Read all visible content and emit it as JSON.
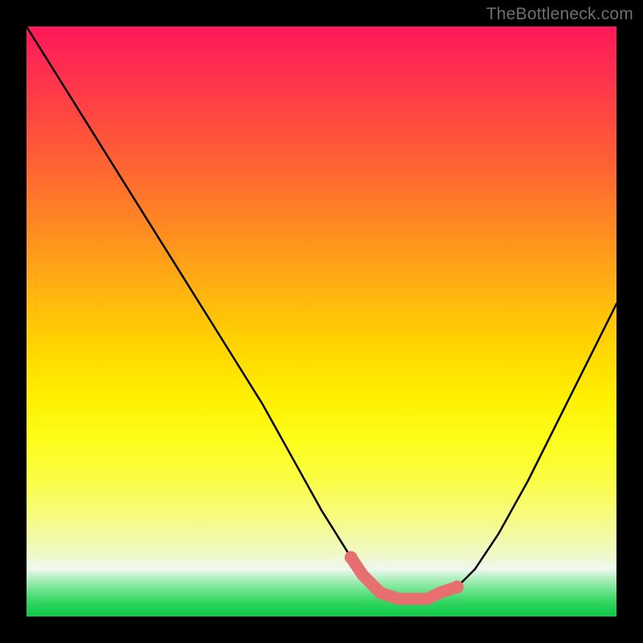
{
  "watermark": "TheBottleneck.com",
  "colors": {
    "frame": "#000000",
    "curve": "#000000",
    "highlight": "#e76f6f",
    "gradient_top": "#ff185a",
    "gradient_bottom": "#10c948"
  },
  "chart_data": {
    "type": "line",
    "title": "",
    "xlabel": "",
    "ylabel": "",
    "xlim": [
      0,
      100
    ],
    "ylim": [
      0,
      100
    ],
    "grid": false,
    "legend": false,
    "annotations": [],
    "series": [
      {
        "name": "bottleneck-curve",
        "x": [
          0,
          5,
          10,
          15,
          20,
          25,
          30,
          35,
          40,
          45,
          50,
          55,
          57,
          60,
          63,
          65,
          68,
          70,
          73,
          76,
          80,
          85,
          90,
          95,
          100
        ],
        "values": [
          100,
          92,
          84,
          76,
          68,
          60,
          52,
          44,
          36,
          27,
          18,
          10,
          7,
          4,
          3,
          3,
          3,
          4,
          5,
          8,
          14,
          23,
          33,
          43,
          53
        ]
      },
      {
        "name": "optimal-highlight",
        "x": [
          55,
          57,
          60,
          63,
          65,
          68,
          70,
          73
        ],
        "values": [
          10,
          7,
          4,
          3,
          3,
          3,
          4,
          5
        ]
      }
    ]
  }
}
